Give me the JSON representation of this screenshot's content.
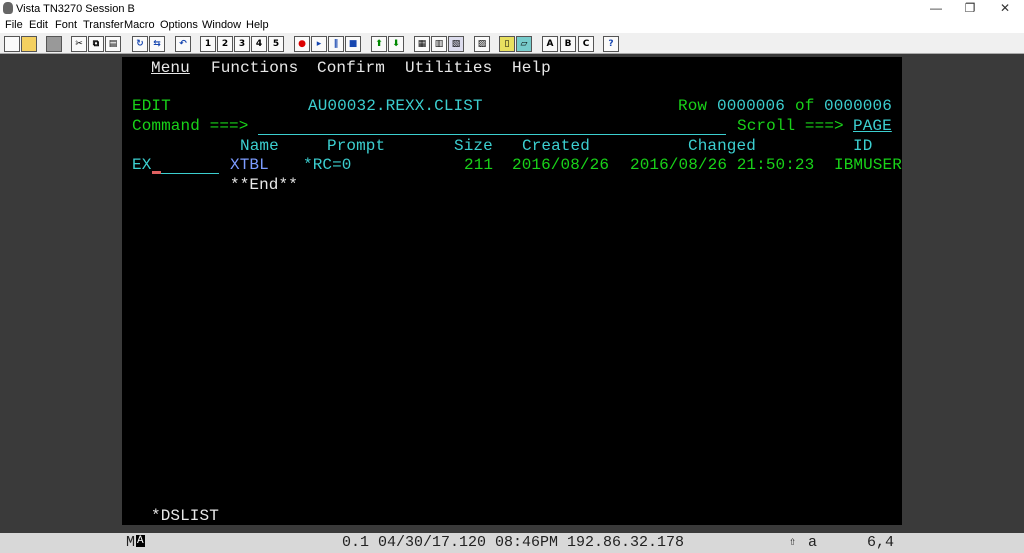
{
  "window": {
    "title": "Vista TN3270 Session B"
  },
  "menubar": [
    "File",
    "Edit",
    "Font",
    "Transfer",
    "Macro",
    "Options",
    "Window",
    "Help"
  ],
  "toolbar": {
    "macro_buttons": [
      "1",
      "2",
      "3",
      "4",
      "5"
    ],
    "letter_buttons": [
      "A",
      "B",
      "C"
    ],
    "help": "?"
  },
  "screen": {
    "action_bar": [
      "Menu",
      "Functions",
      "Confirm",
      "Utilities",
      "Help"
    ],
    "mode": "EDIT",
    "dataset": "AU00032.REXX.CLIST",
    "row_label": "Row",
    "row_current": "0000006",
    "of_label": "of",
    "row_total": "0000006",
    "command_label": "Command ===>",
    "command_value": "",
    "scroll_label": "Scroll ===>",
    "scroll_value": "PAGE",
    "headers": {
      "name": "Name",
      "prompt": "Prompt",
      "size": "Size",
      "created": "Created",
      "changed": "Changed",
      "id": "ID"
    },
    "rows": [
      {
        "cmd": "EX",
        "name": "XTBL",
        "prompt": "*RC=0",
        "size": "211",
        "created": "2016/08/26",
        "changed": "2016/08/26 21:50:23",
        "id": "IBMUSER"
      }
    ],
    "end_marker": "**End**",
    "footer": "*DSLIST"
  },
  "status": {
    "mode": "M",
    "indicator": "A",
    "session_info": "0.1 04/30/17.120 08:46PM 192.86.32.178",
    "kbd": "a",
    "cursor": "6,4"
  },
  "colors": {
    "green": "#19d219",
    "turquoise": "#3ccfd0",
    "blue": "#7c9cff",
    "white": "#e8e8e8"
  }
}
